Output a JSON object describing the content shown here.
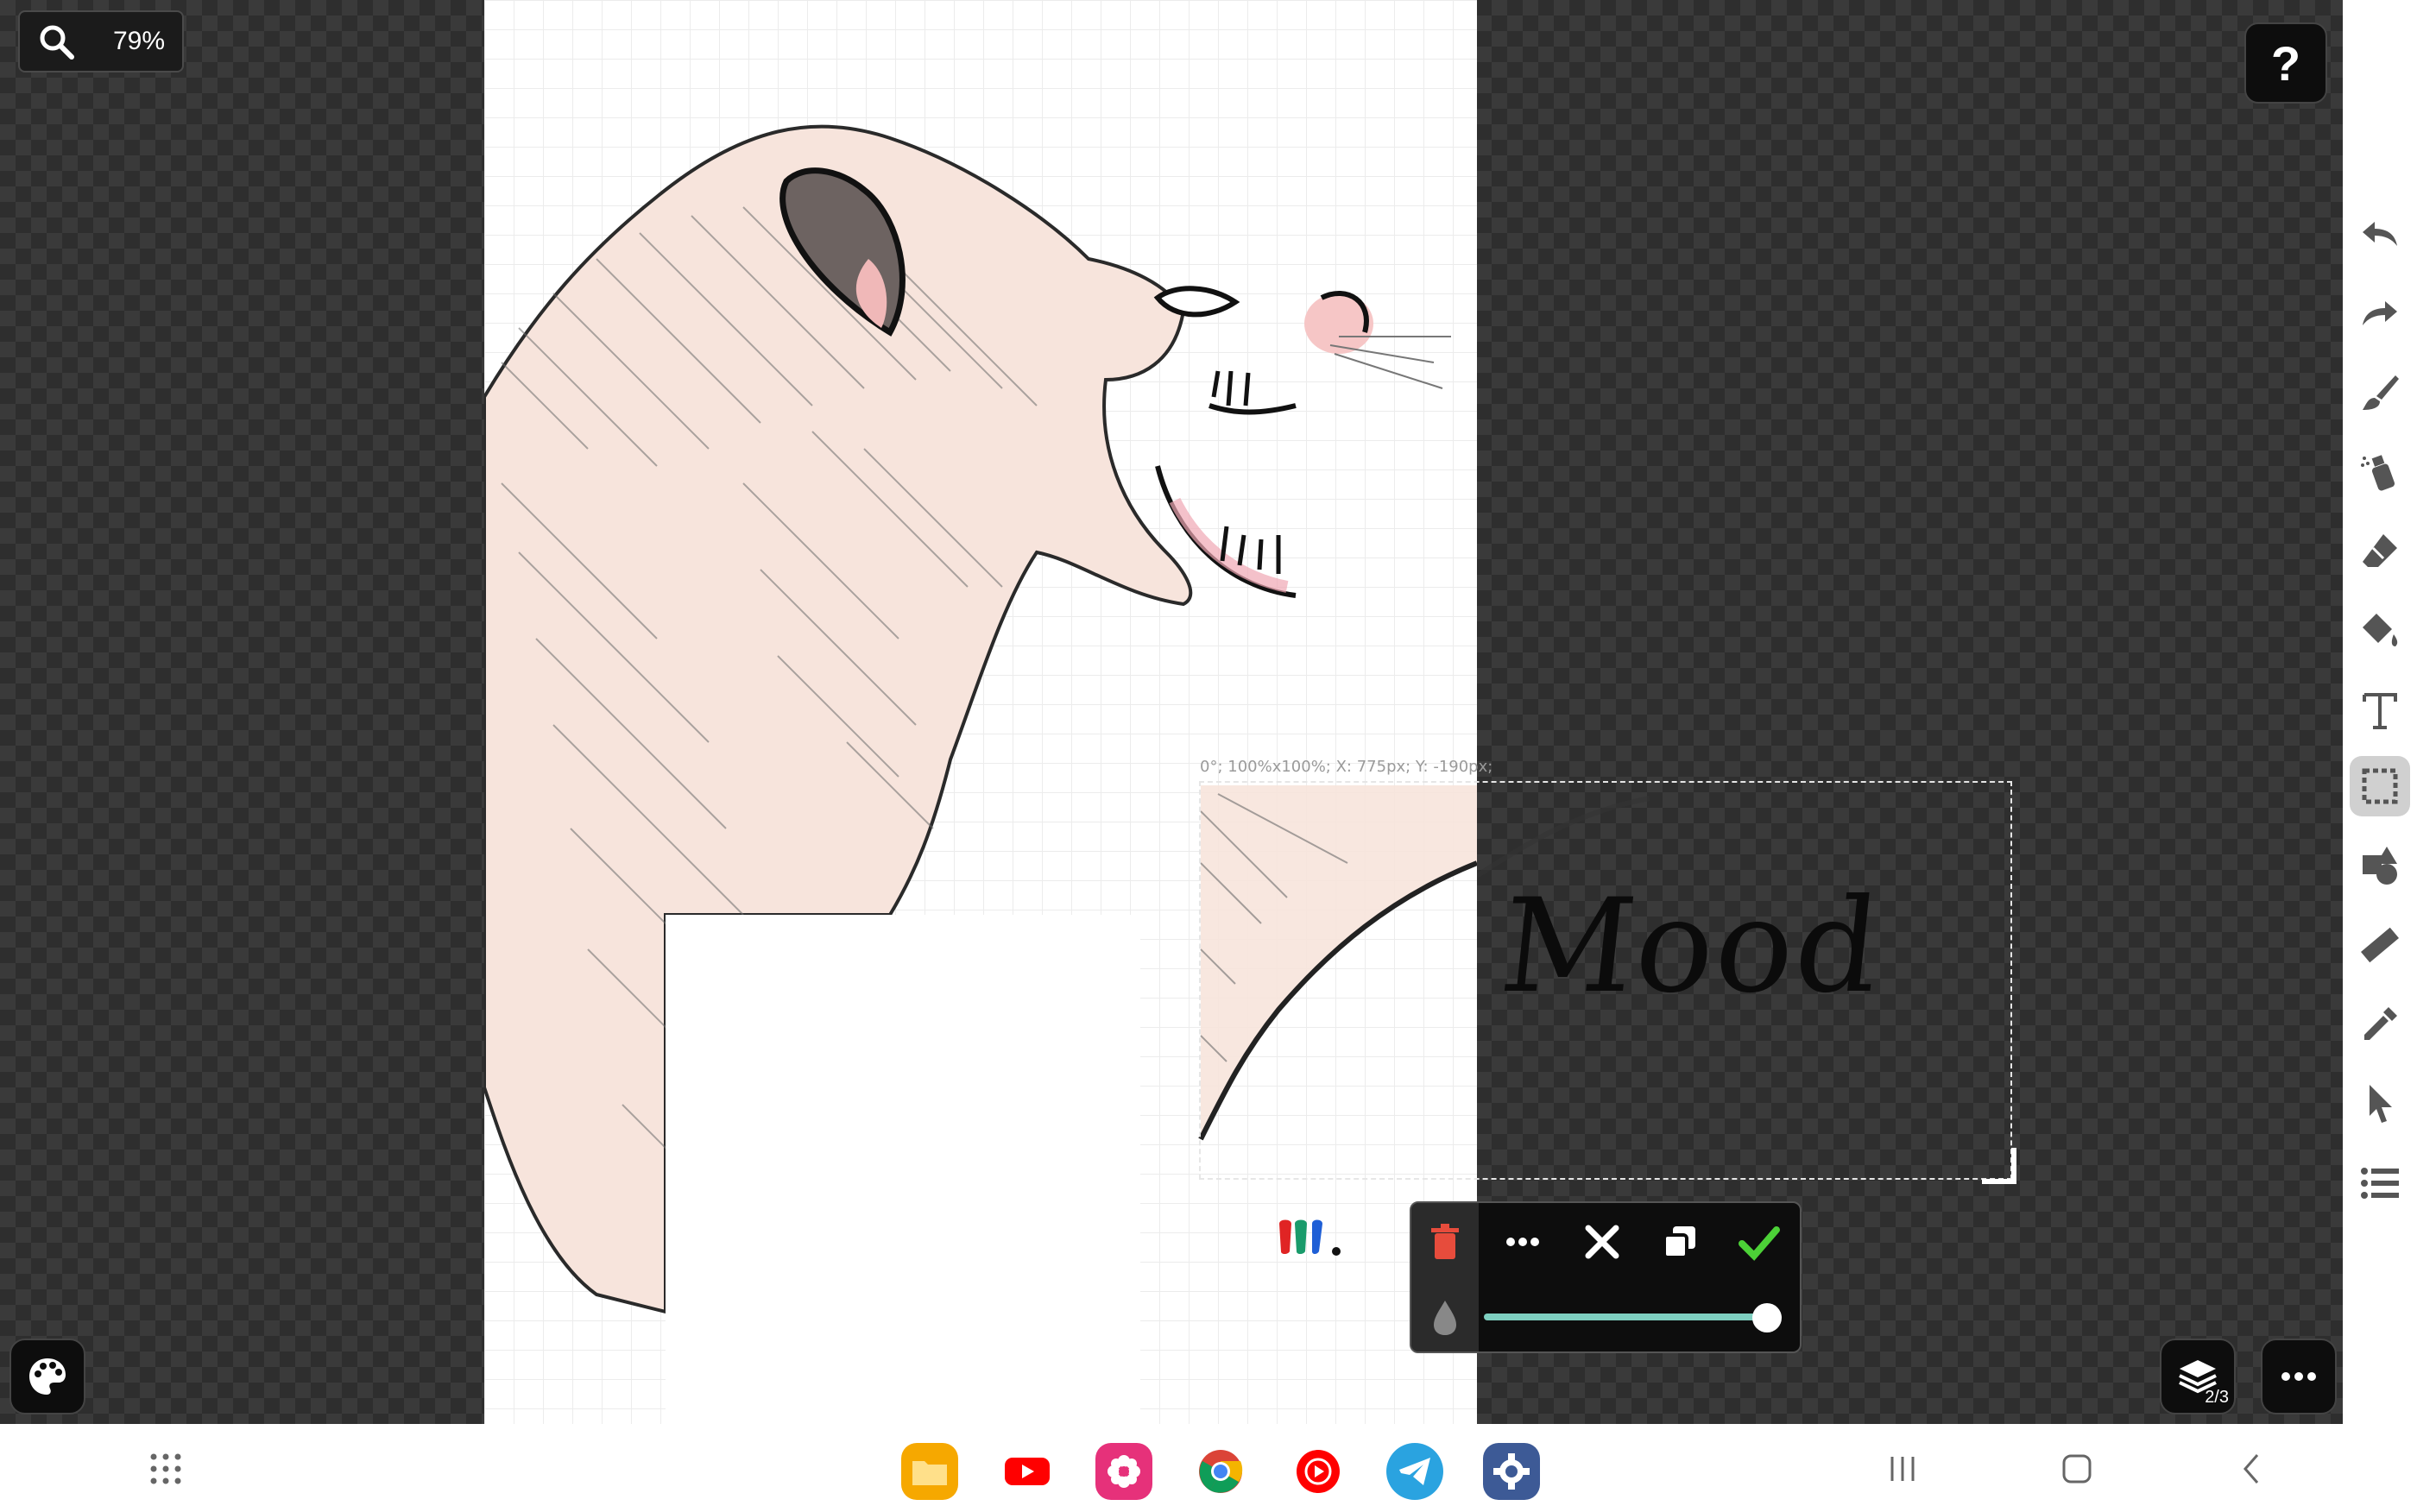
{
  "zoom": {
    "value": "79%"
  },
  "help": {
    "label": "?"
  },
  "selection": {
    "info": "0°; 100%x100%; X: 775px; Y: -190px;"
  },
  "canvas_text": {
    "word": "Mood"
  },
  "layers": {
    "count": "2/3"
  },
  "selection_popup": {
    "actions": [
      "delete",
      "more",
      "cancel",
      "duplicate",
      "confirm"
    ],
    "opacity": 1.0
  },
  "toolbar": {
    "tools": [
      "undo",
      "redo",
      "brush",
      "spray",
      "eraser",
      "fill",
      "text",
      "select",
      "shapes",
      "ruler",
      "eyedropper",
      "pointer",
      "list"
    ],
    "active": "select"
  },
  "dock": {
    "apps": [
      "My Files",
      "YouTube",
      "Gallery",
      "Chrome",
      "YT Music",
      "Telegram",
      "Settings"
    ]
  },
  "colors": {
    "accent": "#7ecfc0",
    "confirm": "#4cd137",
    "delete": "#e74c3c"
  }
}
